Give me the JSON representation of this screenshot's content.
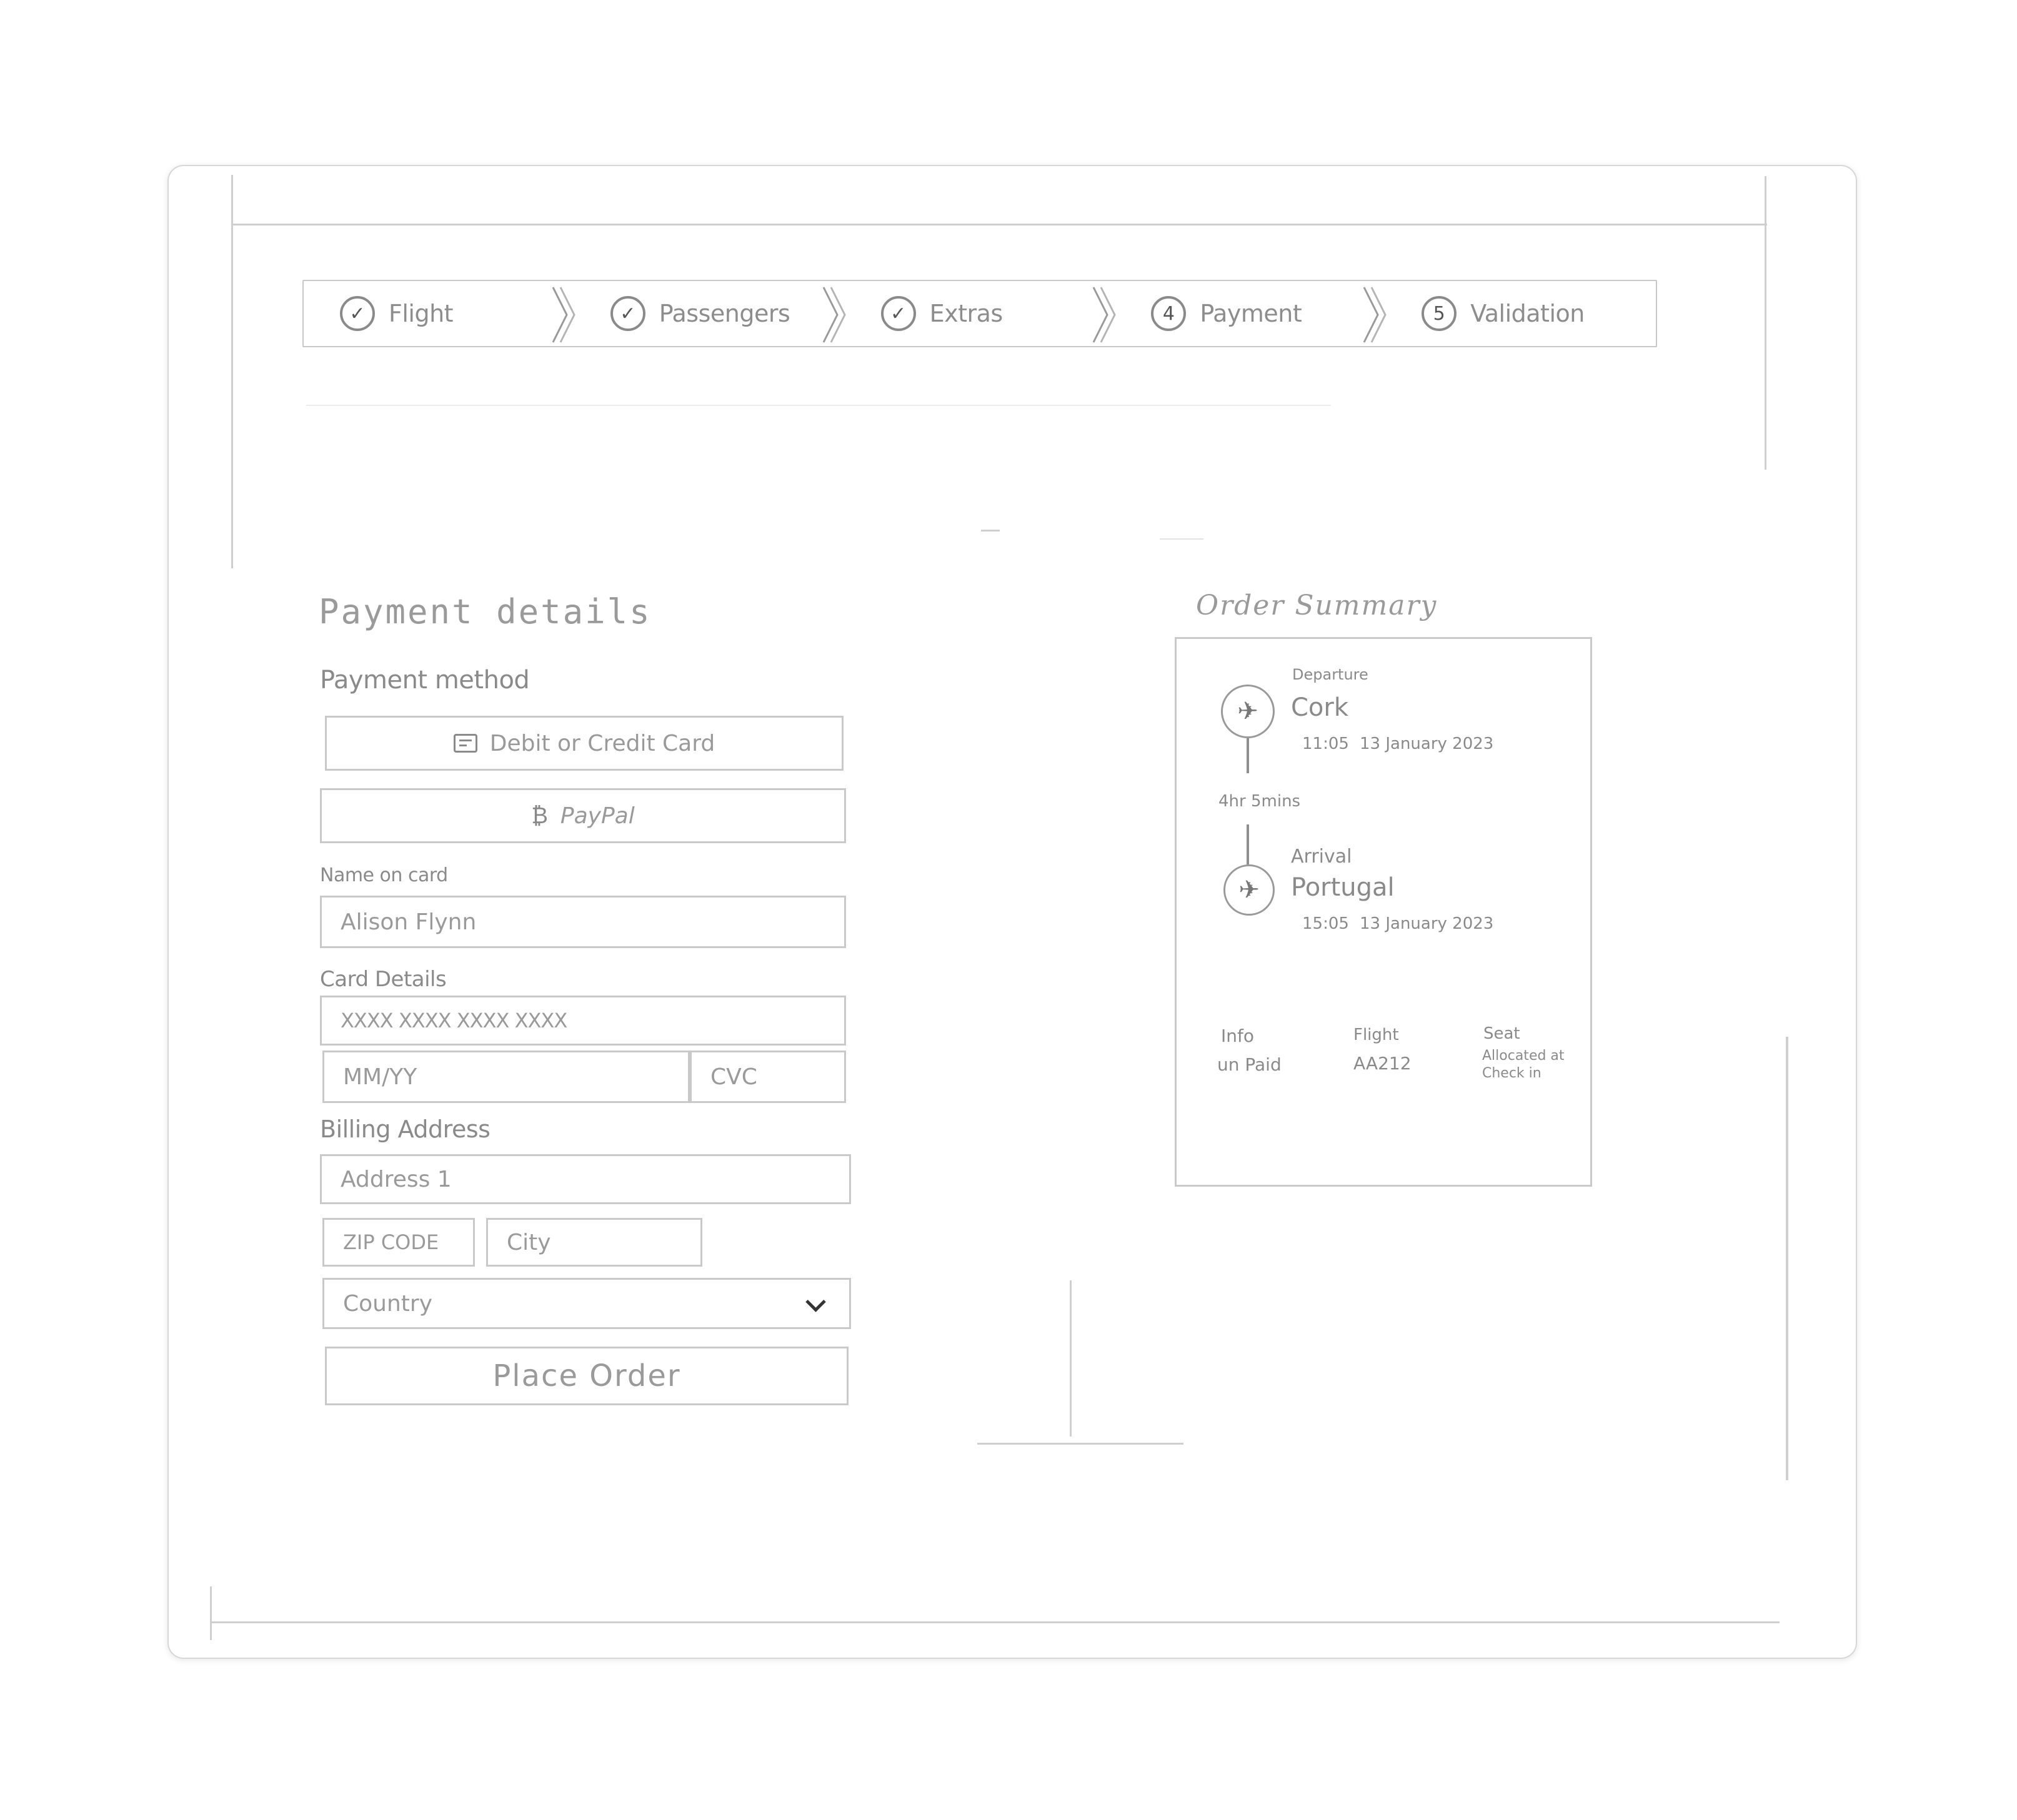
{
  "steps": [
    {
      "label": "Flight",
      "icon": "check-circle-icon",
      "glyph": "✓"
    },
    {
      "label": "Passengers",
      "icon": "check-circle-icon",
      "glyph": "✓"
    },
    {
      "label": "Extras",
      "icon": "check-circle-icon",
      "glyph": "✓"
    },
    {
      "label": "Payment",
      "icon": "step-number-icon",
      "glyph": "4"
    },
    {
      "label": "Validation",
      "icon": "step-number-icon",
      "glyph": "5"
    }
  ],
  "payment": {
    "title": "Payment details",
    "method_label": "Payment method",
    "card_button": "Debit or Credit Card",
    "paypal_glyph": "₿",
    "paypal_button": "PayPal",
    "name_label": "Name on card",
    "name_value": "Alison Flynn",
    "card_label": "Card Details",
    "card_number": "XXXX XXXX XXXX XXXX",
    "expiry_placeholder": "MM/YY",
    "cvc_placeholder": "CVC",
    "billing_label": "Billing Address",
    "address_placeholder": "Address 1",
    "zip_placeholder": "ZIP CODE",
    "city_placeholder": "City",
    "country_placeholder": "Country",
    "place_order": "Place Order"
  },
  "summary": {
    "title": "Order Summary",
    "departure_label": "Departure",
    "departure_city": "Cork",
    "departure_time": "11:05",
    "departure_date": "13 January 2023",
    "duration": "4hr 5mins",
    "arrival_label": "Arrival",
    "arrival_city": "Portugal",
    "arrival_time": "15:05",
    "arrival_date": "13 January 2023",
    "info_label": "Info",
    "info_value": "un Paid",
    "flight_label": "Flight",
    "flight_value": "AA212",
    "seat_label": "Seat",
    "seat_value_1": "Allocated at",
    "seat_value_2": "Check in"
  }
}
